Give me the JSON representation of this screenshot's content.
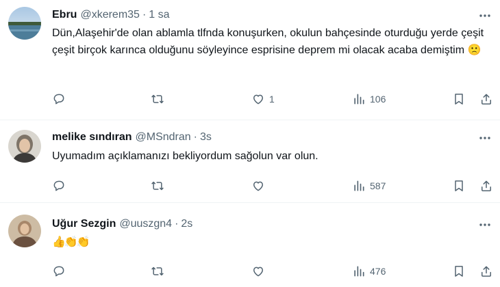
{
  "tweets": [
    {
      "name": "Ebru",
      "handle": "@xkerem35",
      "separator": "·",
      "time": "1 sa",
      "text": "Dün,Alaşehir'de olan ablamla tlfnda konuşurken, okulun bahçesinde oturduğu yerde çeşit çeşit birçok karınca olduğunu söyleyince esprisine deprem mi olacak acaba demiştim 🙁",
      "likes": "1",
      "views": "106",
      "avatar": "landscape-photo"
    },
    {
      "name": "melike sındıran",
      "handle": "@MSndran",
      "separator": "·",
      "time": "3s",
      "text": "Uyumadım açıklamanızı bekliyordum sağolun var olun.",
      "likes": "",
      "views": "587",
      "avatar": "person-photo"
    },
    {
      "name": "Uğur Sezgin",
      "handle": "@uuszgn4",
      "separator": "·",
      "time": "2s",
      "text": "👍👏👏",
      "likes": "",
      "views": "476",
      "avatar": "person-photo"
    }
  ],
  "icons": [
    "reply-icon",
    "retweet-icon",
    "like-icon",
    "views-icon",
    "bookmark-icon",
    "share-icon",
    "more-icon"
  ],
  "colors": {
    "text": "#0f1419",
    "secondary": "#536471",
    "divider": "#eff3f4"
  }
}
